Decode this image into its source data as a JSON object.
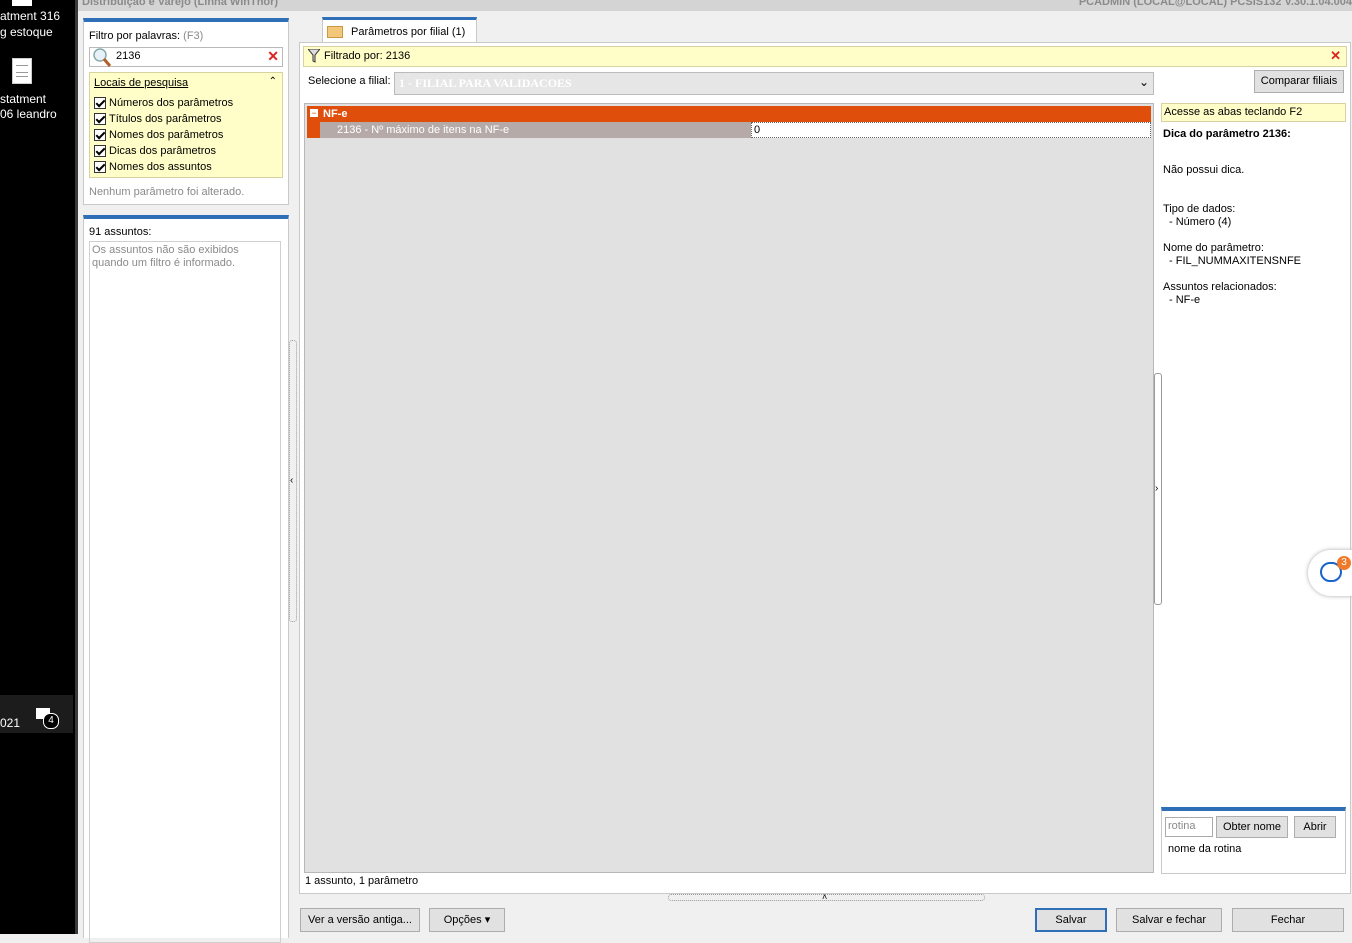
{
  "desktop": {
    "icon1_line1": "atment 316",
    "icon1_line2": "g estoque",
    "icon2_line1": "statment",
    "icon2_line2": "06 leandro",
    "taskbar_date": "021",
    "taskbar_badge": "4"
  },
  "titlebar": {
    "left": "Distribuição e Varejo (Linha WinThor)",
    "right": "PCADMIN (LOCAL@LOCAL)   PCSIS132  V.30.1.04.004"
  },
  "filter": {
    "label": "Filtro por palavras:",
    "shortcut": "(F3)",
    "value": "2136",
    "search_places_title": "Locais de pesquisa",
    "options": [
      "Números dos parâmetros",
      "Títulos dos parâmetros",
      "Nomes dos parâmetros",
      "Dicas dos parâmetros",
      "Nomes dos assuntos"
    ],
    "status": "Nenhum parâmetro foi alterado."
  },
  "subjects": {
    "count_label": "91 assuntos:",
    "message": "Os assuntos não são exibidos quando um filtro é informado."
  },
  "tab": {
    "label": "Parâmetros por filial  (1)"
  },
  "filterbar": {
    "text": "Filtrado por: 2136"
  },
  "branch": {
    "label": "Selecione a filial:",
    "selected": "1 - FILIAL PARA VALIDACOES",
    "compare_button": "Comparar filiais"
  },
  "grid": {
    "group": "NF-e",
    "group_toggle": "−",
    "rows": [
      {
        "name": "2136 - Nº máximo de itens na NF-e",
        "value": "0"
      }
    ]
  },
  "statusbar": {
    "text": "1 assunto, 1 parâmetro"
  },
  "hint": {
    "access_tip": "Acesse as abas teclando F2",
    "title": "Dica do parâmetro 2136:",
    "no_hint": "Não possui dica.",
    "data_type_label": "Tipo de dados:",
    "data_type_value": "- Número (4)",
    "param_name_label": "Nome do parâmetro:",
    "param_name_value": "- FIL_NUMMAXITENSNFE",
    "related_label": "Assuntos relacionados:",
    "related_value": "- NF-e"
  },
  "routine": {
    "placeholder": "rotina",
    "get_name_button": "Obter nome",
    "open_button": "Abrir",
    "name_label": "nome da rotina"
  },
  "footer": {
    "old_version_button": "Ver a versão antiga...",
    "options_button": "Opções",
    "save_button": "Salvar",
    "save_close_button": "Salvar e fechar",
    "close_button": "Fechar"
  },
  "chat": {
    "badge": "3"
  },
  "colors": {
    "accent_blue": "#2e6fb7",
    "group_orange": "#e04e0c",
    "row_selected": "#b5aaa8",
    "hint_yellow": "#fffec8"
  }
}
